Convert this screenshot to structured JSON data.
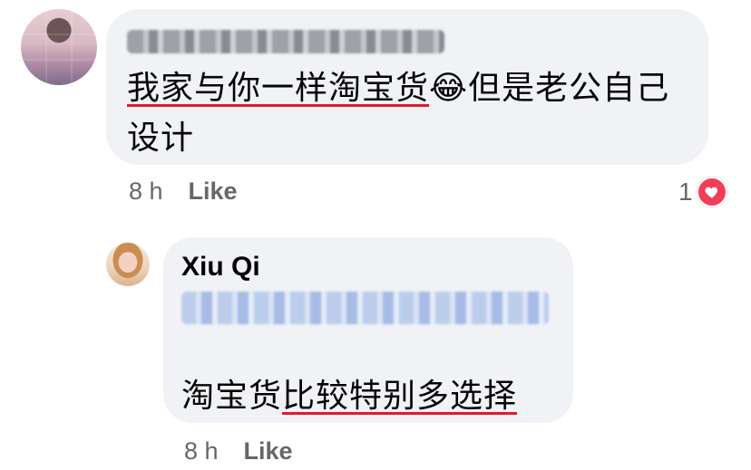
{
  "comment": {
    "author_blurred": "",
    "text_underlined": "我家与你一样淘宝货",
    "emoji": "😂",
    "text_rest": "但是老公自己设计",
    "time": "8 h",
    "like_label": "Like",
    "reaction_count": "1"
  },
  "reply": {
    "author": "Xiu Qi",
    "mention_blurred": "",
    "text_plain": "淘宝货",
    "text_underlined": "比较特别多选择",
    "time": "8 h",
    "like_label": "Like"
  },
  "colors": {
    "bubble": "#f0f2f5",
    "meta_text": "#65676b",
    "underline": "#e01b24",
    "heart": "#f33e58",
    "mention_blue": "#b7c9ec"
  },
  "icons": {
    "reaction": "heart-icon"
  }
}
